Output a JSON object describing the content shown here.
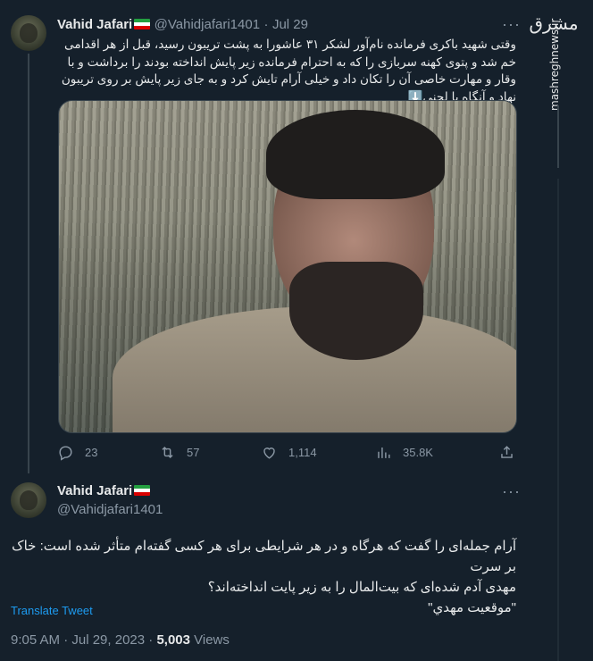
{
  "watermark": {
    "logo_text": "مشرق",
    "url": "mashreghnews.ir"
  },
  "tweet1": {
    "author_name": "Vahid Jafari",
    "handle": "@Vahidjafari1401",
    "date": "Jul 29",
    "text": "وقتی شهید باکری فرمانده نام‌آور لشکر ۳۱ عاشورا به پشت تریبون رسید، قبل از هر اقدامی خم شد و پتوی کهنه سربازی را که به احترام فرمانده زیر پایش انداخته بودند را برداشت و با وقار و مهارت خاصی آن را تکان داد و خیلی آرام تایش کرد و به جای زیر پایش بر روی تریبون نهاد و آنگاه با لحنی⬇️",
    "stats": {
      "replies": "23",
      "retweets": "57",
      "likes": "1,114",
      "views": "35.8K"
    }
  },
  "tweet2": {
    "author_name": "Vahid Jafari",
    "handle": "@Vahidjafari1401",
    "text_line1": "آرام جمله‌ای را گفت که هرگاه و در هر شرایطی برای هر کسی گفته‌ام متأثر شده است: خاک بر سرت",
    "text_line2": "مهدی آدم شده‌ای که بیت‌المال را به زیر پایت انداخته‌اند؟",
    "text_line3": "\"موقعیت مهدي\"",
    "translate_label": "Translate Tweet",
    "time": "9:05 AM · Jul 29, 2023 · ",
    "views_count": "5,003",
    "views_label": " Views"
  }
}
